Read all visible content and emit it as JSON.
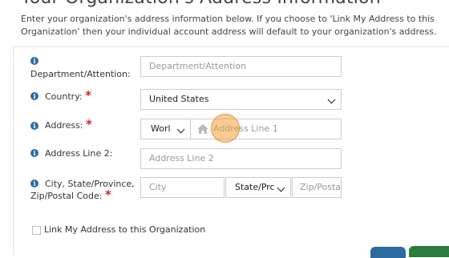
{
  "page": {
    "heading": "Your Organization's Address Information",
    "intro": "Enter your organization's address information below. If you choose to 'Link My Address to this Organization' then your individual account address will default to your organization's address."
  },
  "form": {
    "department": {
      "label": "Department/Attention:",
      "placeholder": "Department/Attention"
    },
    "country": {
      "label": "Country:",
      "required": "*",
      "value": "United States"
    },
    "address": {
      "label": "Address:",
      "required": "*",
      "type_value": "Worl",
      "line1_placeholder": "Address Line 1"
    },
    "address2": {
      "label": "Address Line 2:",
      "placeholder": "Address Line 2"
    },
    "city_state_zip": {
      "label_line1": "City, State/Province,",
      "label_line2": "Zip/Postal Code:",
      "required": "*",
      "city_placeholder": "City",
      "state_value": "State/Prc",
      "zip_placeholder": "Zip/Posta"
    },
    "link_checkbox_label": "Link My Address to this Organization"
  },
  "icons": {
    "info": "info-icon",
    "home": "home-icon",
    "dropdown": "chevron-down-icon"
  },
  "colors": {
    "accent_blue": "#2d6aa0",
    "required_red": "#d1222b",
    "action_green": "#2a7d3b",
    "cursor_orange": "#f4a03c"
  }
}
